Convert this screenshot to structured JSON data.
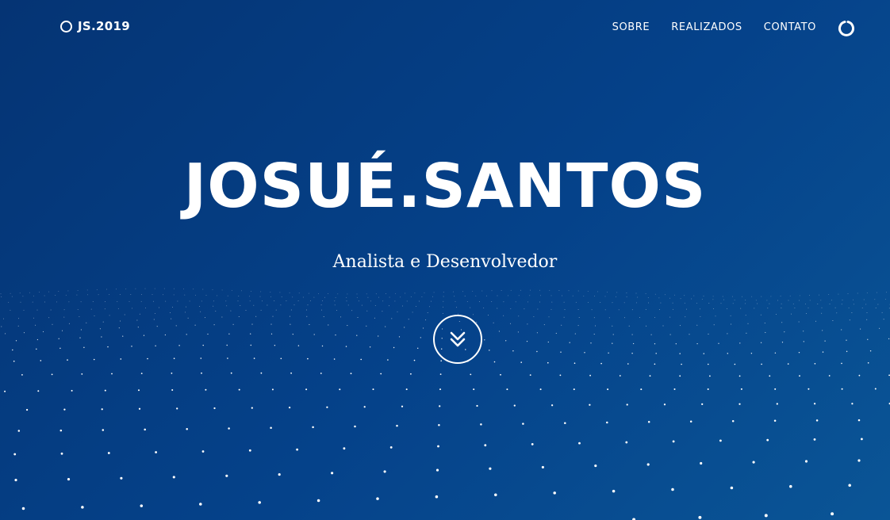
{
  "brand": {
    "label": "JS.2019",
    "icon": "ring-icon"
  },
  "nav": {
    "items": [
      {
        "label": "SOBRE"
      },
      {
        "label": "REALIZADOS"
      },
      {
        "label": "CONTATO"
      }
    ],
    "action_icon": "ring-icon"
  },
  "hero": {
    "title": "JOSUÉ.SANTOS",
    "subtitle": "Analista e Desenvolvedor",
    "scroll_icon": "double-chevron-down-icon"
  },
  "colors": {
    "background_start": "#053474",
    "background_end": "#0a5596",
    "foreground": "#ffffff"
  }
}
